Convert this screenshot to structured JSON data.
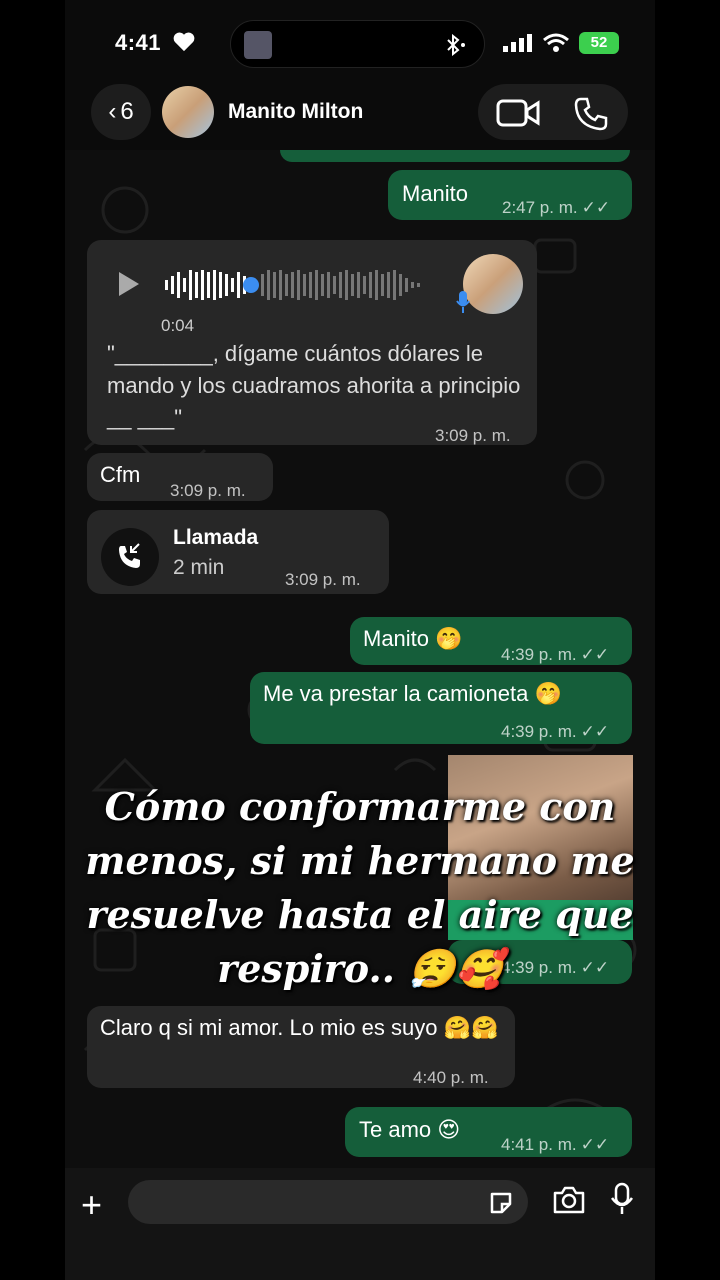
{
  "status_bar": {
    "time": "4:41",
    "battery": "52"
  },
  "header": {
    "back_count": "6",
    "contact_name": "Manito Milton"
  },
  "messages": [
    {
      "id": "m1",
      "text": "Manito",
      "time": "2:47 p. m."
    },
    {
      "id": "m2",
      "duration": "0:04",
      "transcript": "\"________, dígame cuántos dólares le mando y los cuadramos ahorita a principio __ ___\"",
      "time": "3:09 p. m."
    },
    {
      "id": "m3",
      "text": "Cfm",
      "time": "3:09 p. m."
    },
    {
      "id": "m4",
      "title": "Llamada",
      "duration": "2 min",
      "time": "3:09 p. m."
    },
    {
      "id": "m5",
      "text": "Manito 🤭",
      "time": "4:39 p. m."
    },
    {
      "id": "m6",
      "text": "Me va prestar la camioneta 🤭",
      "time": "4:39 p. m."
    },
    {
      "id": "m7",
      "time": "4:39 p. m."
    },
    {
      "id": "m8",
      "text": "Claro q si mi amor. Lo mio es suyo 🤗🤗",
      "time": "4:40 p. m."
    },
    {
      "id": "m9",
      "text": "Te amo 😍",
      "time": "4:41 p. m."
    }
  ],
  "overlay_caption": "Cómo conformarme con menos, si mi hermano me resuelve hasta el aire que respiro.. 😮‍💨🥰",
  "colors": {
    "outgoing_bubble": "#155e3a",
    "incoming_bubble": "#272727",
    "background": "#0e0e0e"
  }
}
